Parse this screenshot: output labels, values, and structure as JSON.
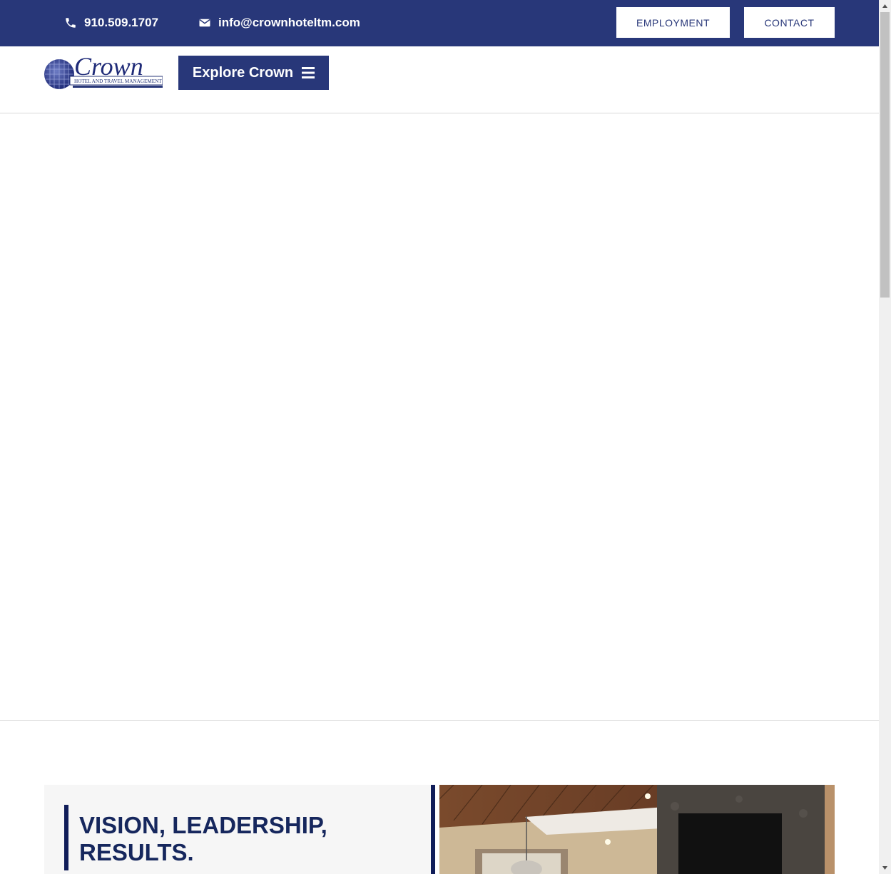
{
  "topbar": {
    "phone": "910.509.1707",
    "email": "info@crownhoteltm.com",
    "phone_icon": "phone-icon",
    "email_icon": "envelope-icon",
    "employment_label": "EMPLOYMENT",
    "contact_label": "CONTACT"
  },
  "header": {
    "logo_text": "Crown",
    "logo_subtext": "HOTEL AND TRAVEL MANAGEMENT",
    "explore_label": "Explore Crown",
    "menu_icon": "hamburger-icon"
  },
  "vision": {
    "title_line1": "VISION, LEADERSHIP,",
    "title_line2": "RESULTS."
  },
  "colors": {
    "brand_navy": "#283779",
    "heading_navy": "#16275d",
    "accent_bar": "#101d59",
    "card_bg": "#f6f6f6"
  }
}
